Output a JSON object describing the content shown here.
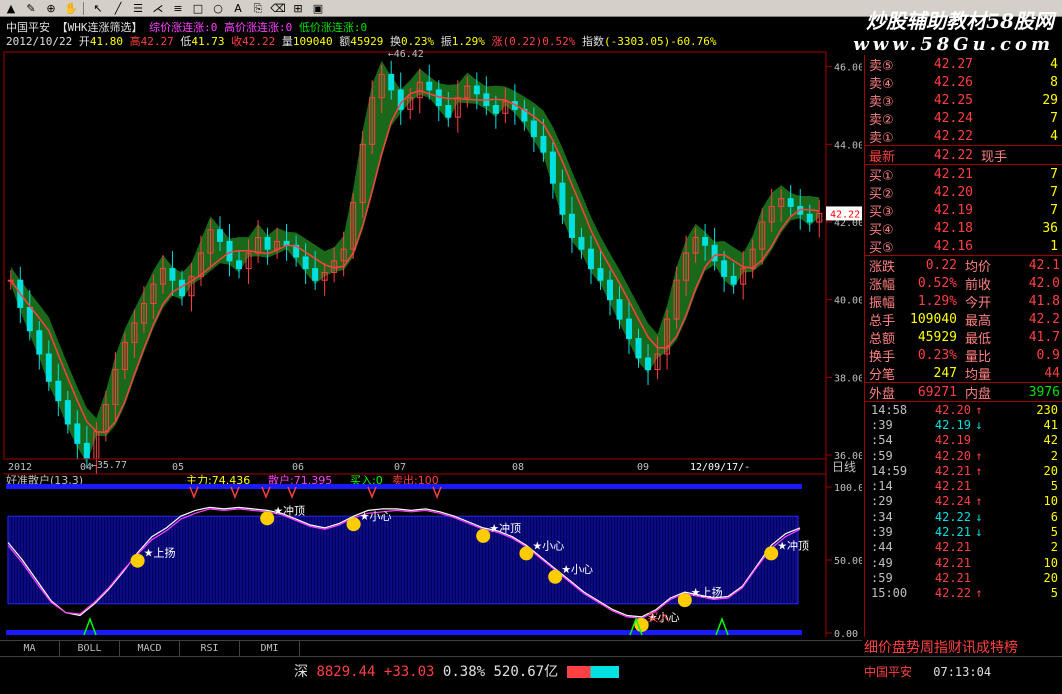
{
  "toolbar": {
    "icons": [
      "arrow-up-icon",
      "brush-icon",
      "zoom-icon",
      "hand-icon",
      "dropdown-icon",
      "cursor-icon",
      "line-icon",
      "grid-icon",
      "fan-icon",
      "channel-icon",
      "rect-icon",
      "ellipse-icon",
      "text-icon",
      "copy-icon",
      "eraser-icon",
      "lock-icon",
      "save-icon"
    ]
  },
  "watermark": {
    "line1": "炒股辅助教材58股网",
    "line2": "www.58Gu.com"
  },
  "header": {
    "stock": "中国平安",
    "indicator": "【WHK连涨筛选】",
    "ind1": "综价涨连涨:0",
    "ind2": "高价涨连涨:0",
    "ind3": "低价涨连涨:0",
    "date": "2012/10/22",
    "open_label": "开",
    "open": "41.80",
    "high_label": "高",
    "high": "42.27",
    "low_label": "低",
    "low": "41.73",
    "close_label": "收",
    "close": "42.22",
    "vol_label": "量",
    "vol": "109040",
    "amt_label": "额",
    "amt": "45929",
    "turn_label": "换",
    "turn": "0.23%",
    "amp_label": "振",
    "amp": "1.29%",
    "chg_label": "涨",
    "chg": "(0.22)0.52%",
    "idx_label": "指数",
    "idx": "(-3303.05)-60.76%"
  },
  "chart_data": [
    {
      "type": "line",
      "title": "",
      "x_labels": [
        "2012",
        "04",
        "05",
        "06",
        "07",
        "08",
        "09",
        "12/09/17/-"
      ],
      "y_ticks": [
        "46.00",
        "44.00",
        "42.00",
        "40.00",
        "38.00",
        "36.00"
      ],
      "ylim": [
        36,
        46.3
      ],
      "annotations": {
        "high_label": "46.42",
        "low_label": "35.77",
        "current_price": "42.22",
        "period_label": "日线"
      },
      "series": [
        {
          "name": "close",
          "values": [
            40.5,
            39.8,
            39.2,
            38.6,
            37.9,
            37.4,
            36.8,
            36.3,
            35.9,
            36.6,
            37.3,
            38.2,
            38.9,
            39.4,
            39.9,
            40.4,
            40.8,
            40.5,
            40.1,
            40.6,
            41.2,
            41.8,
            41.5,
            41.0,
            40.8,
            41.2,
            41.6,
            41.3,
            41.5,
            41.4,
            41.1,
            40.8,
            40.5,
            40.7,
            41.0,
            41.3,
            42.5,
            44.0,
            45.2,
            45.8,
            45.4,
            44.9,
            45.2,
            45.6,
            45.4,
            45.0,
            44.7,
            45.2,
            45.5,
            45.3,
            45.0,
            44.8,
            45.1,
            44.9,
            44.6,
            44.2,
            43.8,
            43.0,
            42.2,
            41.6,
            41.3,
            40.8,
            40.5,
            40.0,
            39.5,
            39.0,
            38.5,
            38.2,
            38.6,
            39.5,
            40.5,
            41.2,
            41.6,
            41.4,
            41.0,
            40.6,
            40.4,
            40.8,
            41.3,
            42.0,
            42.4,
            42.6,
            42.4,
            42.2,
            42.0,
            42.22
          ]
        }
      ]
    },
    {
      "type": "line",
      "title": "好准散户(13,3)",
      "ylim": [
        0,
        100
      ],
      "y_ticks": [
        "100.00",
        "50.00",
        "0.00"
      ],
      "legend": [
        {
          "label": "主力:74.436",
          "color": "#ffff00"
        },
        {
          "label": "散户:71.395",
          "color": "#ff40ff"
        },
        {
          "label": "买入:0",
          "color": "#00ff00"
        },
        {
          "label": "卖出:100",
          "color": "#ff4040"
        }
      ],
      "markers": [
        "上扬",
        "冲顶",
        "小心",
        "冲顶",
        "小心",
        "小心",
        "小心",
        "上扬",
        "冲顶",
        "买入"
      ],
      "series": [
        {
          "name": "主力",
          "values": [
            62,
            50,
            36,
            22,
            14,
            12,
            20,
            30,
            42,
            55,
            66,
            72,
            80,
            84,
            86,
            85,
            86,
            85,
            84,
            82,
            78,
            74,
            72,
            75,
            80,
            84,
            85,
            85,
            84,
            85,
            83,
            80,
            76,
            72,
            70,
            66,
            60,
            52,
            44,
            36,
            28,
            22,
            16,
            12,
            11,
            16,
            24,
            28,
            26,
            24,
            25,
            32,
            46,
            60,
            68,
            72
          ]
        },
        {
          "name": "散户",
          "values": [
            60,
            48,
            34,
            21,
            14,
            13,
            21,
            31,
            43,
            54,
            64,
            70,
            78,
            82,
            85,
            84,
            85,
            84,
            83,
            81,
            77,
            73,
            71,
            74,
            79,
            82,
            83,
            84,
            83,
            84,
            82,
            79,
            75,
            71,
            69,
            65,
            59,
            51,
            43,
            35,
            27,
            21,
            15,
            11,
            10,
            15,
            23,
            27,
            25,
            23,
            24,
            31,
            45,
            58,
            66,
            71
          ]
        }
      ]
    }
  ],
  "quote": {
    "asks": [
      {
        "label": "卖⑤",
        "price": "42.27",
        "vol": "4"
      },
      {
        "label": "卖④",
        "price": "42.26",
        "vol": "8"
      },
      {
        "label": "卖③",
        "price": "42.25",
        "vol": "29"
      },
      {
        "label": "卖②",
        "price": "42.24",
        "vol": "7"
      },
      {
        "label": "卖①",
        "price": "42.22",
        "vol": "4"
      }
    ],
    "last_label": "最新",
    "last": "42.22",
    "last_unit": "现手",
    "bids": [
      {
        "label": "买①",
        "price": "42.21",
        "vol": "7"
      },
      {
        "label": "买②",
        "price": "42.20",
        "vol": "7"
      },
      {
        "label": "买③",
        "price": "42.19",
        "vol": "7"
      },
      {
        "label": "买④",
        "price": "42.18",
        "vol": "36"
      },
      {
        "label": "买⑤",
        "price": "42.16",
        "vol": "1"
      }
    ],
    "stats": [
      {
        "l1": "涨跌",
        "v1": "0.22",
        "l2": "均价",
        "v2": "42.1"
      },
      {
        "l1": "涨幅",
        "v1": "0.52%",
        "l2": "前收",
        "v2": "42.0"
      },
      {
        "l1": "振幅",
        "v1": "1.29%",
        "l2": "今开",
        "v2": "41.8"
      },
      {
        "l1": "总手",
        "v1": "109040",
        "l2": "最高",
        "v2": "42.2"
      },
      {
        "l1": "总额",
        "v1": "45929",
        "l2": "最低",
        "v2": "41.7"
      },
      {
        "l1": "换手",
        "v1": "0.23%",
        "l2": "量比",
        "v2": "0.9"
      },
      {
        "l1": "分笔",
        "v1": "247",
        "l2": "均量",
        "v2": "44"
      }
    ],
    "outer_label": "外盘",
    "outer": "69271",
    "inner_label": "内盘",
    "inner": "3976",
    "ticks": [
      {
        "time": "14:58",
        "price": "42.20",
        "dir": "↑",
        "vol": "230"
      },
      {
        "time": ":39",
        "price": "42.19",
        "dir": "↓",
        "vol": "41"
      },
      {
        "time": ":54",
        "price": "42.19",
        "dir": "",
        "vol": "42"
      },
      {
        "time": ":59",
        "price": "42.20",
        "dir": "↑",
        "vol": "2"
      },
      {
        "time": "14:59",
        "price": "42.21",
        "dir": "↑",
        "vol": "20"
      },
      {
        "time": ":14",
        "price": "42.21",
        "dir": "",
        "vol": "5"
      },
      {
        "time": ":29",
        "price": "42.24",
        "dir": "↑",
        "vol": "10"
      },
      {
        "time": ":34",
        "price": "42.22",
        "dir": "↓",
        "vol": "6"
      },
      {
        "time": ":39",
        "price": "42.21",
        "dir": "↓",
        "vol": "5"
      },
      {
        "time": ":44",
        "price": "42.21",
        "dir": "",
        "vol": "2"
      },
      {
        "time": ":49",
        "price": "42.21",
        "dir": "",
        "vol": "10"
      },
      {
        "time": ":59",
        "price": "42.21",
        "dir": "",
        "vol": "20"
      },
      {
        "time": "15:00",
        "price": "42.22",
        "dir": "↑",
        "vol": "5"
      }
    ]
  },
  "tabs": [
    "MA",
    "BOLL",
    "MACD",
    "RSI",
    "DMI"
  ],
  "status": {
    "index_name": "深",
    "index_val": "8829.44",
    "index_chg": "+33.03",
    "index_pct": "0.38%",
    "index_amt": "520.67亿",
    "marquee": "细价盘势周指财讯成特榜",
    "stock": "中国平安",
    "time": "07:13:04"
  },
  "colors": {
    "bg": "#000000",
    "up": "#ff4040",
    "down": "#00e0e0",
    "cloud": "#1f7a1f",
    "axis": "#a00000"
  }
}
